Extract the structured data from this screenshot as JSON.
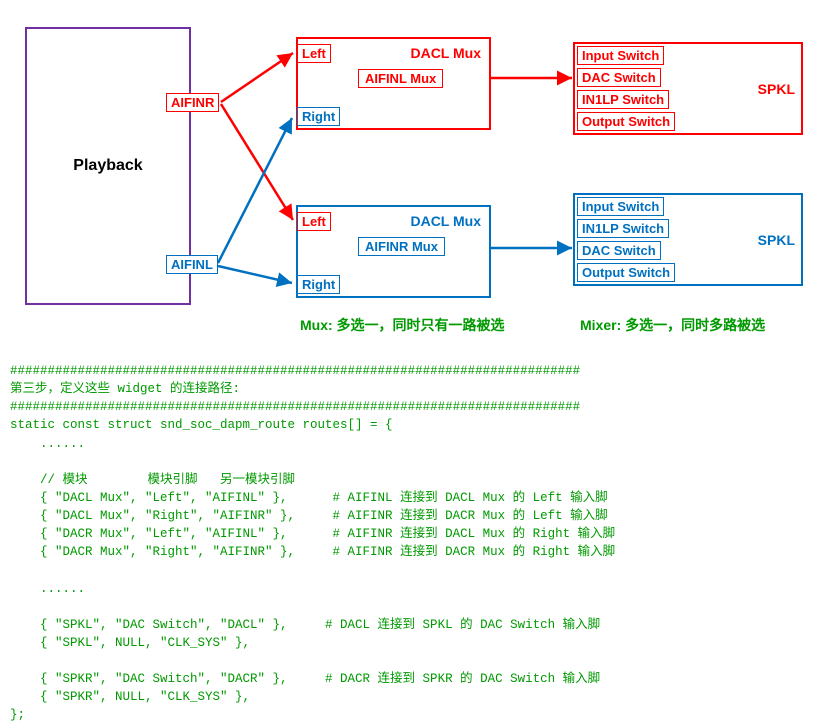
{
  "diagram": {
    "playback": "Playback",
    "pins": {
      "aifinr": "AIFINR",
      "aifinl": "AIFINL"
    },
    "mux_top": {
      "title": "DACL Mux",
      "left": "Left",
      "right": "Right",
      "sub": "AIFINL Mux"
    },
    "mux_bot": {
      "title": "DACL Mux",
      "left": "Left",
      "right": "Right",
      "sub": "AIFINR Mux"
    },
    "mixer_top": {
      "title": "SPKL",
      "rows": [
        "Input Switch",
        "DAC Switch",
        "IN1LP Switch",
        "Output Switch"
      ]
    },
    "mixer_bot": {
      "title": "SPKL",
      "rows": [
        "Input Switch",
        "IN1LP Switch",
        "DAC Switch",
        "Output Switch"
      ]
    },
    "caption_mux": "Mux: 多选一，同时只有一路被选",
    "caption_mixer": "Mixer: 多选一，同时多路被选"
  },
  "code": {
    "bar": "############################################################################",
    "step": "第三步，定义这些 widget 的连接路径:",
    "decl": "static const struct snd_soc_dapm_route routes[] = {",
    "dots": "    ......",
    "comment_header": "    // 模块        模块引脚   另一模块引脚",
    "r1": "    { \"DACL Mux\", \"Left\", \"AIFINL\" },      # AIFINL 连接到 DACL Mux 的 Left 输入脚",
    "r2": "    { \"DACL Mux\", \"Right\", \"AIFINR\" },     # AIFINR 连接到 DACR Mux 的 Left 输入脚",
    "r3": "    { \"DACR Mux\", \"Left\", \"AIFINL\" },      # AIFINR 连接到 DACL Mux 的 Right 输入脚",
    "r4": "    { \"DACR Mux\", \"Right\", \"AIFINR\" },     # AIFINR 连接到 DACR Mux 的 Right 输入脚",
    "s1": "    { \"SPKL\", \"DAC Switch\", \"DACL\" },     # DACL 连接到 SPKL 的 DAC Switch 输入脚",
    "s2": "    { \"SPKL\", NULL, \"CLK_SYS\" },",
    "s3": "    { \"SPKR\", \"DAC Switch\", \"DACR\" },     # DACR 连接到 SPKR 的 DAC Switch 输入脚",
    "s4": "    { \"SPKR\", NULL, \"CLK_SYS\" },",
    "end": "};"
  }
}
